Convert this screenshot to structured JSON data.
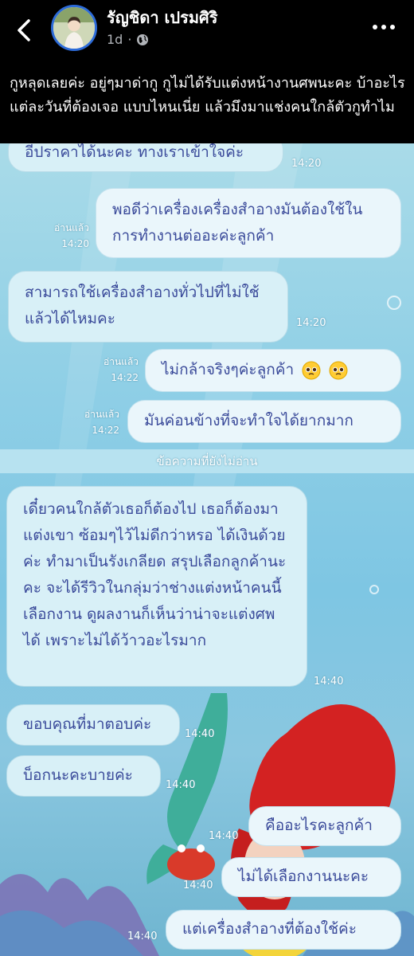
{
  "post": {
    "author_name": "รัญชิดา เปรมศิริ",
    "time_ago": "1d",
    "caption": "กูหลุดเลยค่ะ อยู่ๆมาด่ากู กูไม่ได้รับแต่งหน้างานศพนะคะ บ้าอะไร แต่ละวันที่ต้องเจอ แบบไหนเนี่ย แล้วมึงมาแช่งคนใกล้ตัวกูทำไม"
  },
  "chat": {
    "unread_label": "ข้อความที่ยังไม่อ่าน",
    "messages": [
      {
        "text": "อีปราคาได้นะคะ ทางเราเข้าใจค่ะ",
        "time": "14:20"
      },
      {
        "text": "พอดีว่าเครื่องเครื่องสำอางมันต้องใช้ในการทำงานต่ออะค่ะลูกค้า",
        "time": "14:20",
        "read": "อ่านแล้ว"
      },
      {
        "text": "สามารถใช้เครื่องสำอางทั่วไปที่ไม่ใช้แล้วได้ไหมคะ",
        "time": "14:20"
      },
      {
        "text": "ไม่กล้าจริงๆค่ะลูกค้า",
        "time": "14:22",
        "read": "อ่านแล้ว"
      },
      {
        "text": "มันค่อนข้างที่จะทำใจได้ยากมาก",
        "time": "14:22",
        "read": "อ่านแล้ว"
      },
      {
        "text": "เดี๋ยวคนใกล้ตัวเธอก็ต้องไป เธอก็ต้องมาแต่งเขา ซ้อมๆไว้ไม่ดีกว่าหรอ ได้เงินด้วยค่ะ ทำมาเป็นรังเกลียด สรุปเลือกลูกค้านะคะ จะได้รีวิวในกลุ่มว่าช่างแต่งหน้าคนนี้เลือกงาน ดูผลงานก็เห็นว่าน่าจะแต่งศพได้ เพราะไม่ได้ว้าวอะไรมาก",
        "time": "14:40"
      },
      {
        "text": "ขอบคุณที่มาตอบค่ะ",
        "time": "14:40"
      },
      {
        "text": "บ็อกนะคะบายค่ะ",
        "time": "14:40"
      },
      {
        "text": "คืออะไรคะลูกค้า",
        "time": "14:40"
      },
      {
        "text": "ไม่ได้เลือกงานนะคะ",
        "time": "14:40"
      },
      {
        "text": "แต่เครื่องสำอางที่ต้องใช้ค่ะ",
        "time": "14:40"
      }
    ]
  },
  "icons": {
    "back": "chevron-left-icon",
    "more": "more-dots-icon",
    "privacy": "globe-icon",
    "emoji": "pleading-face-emoji"
  },
  "colors": {
    "header_bg": "#000000",
    "avatar_ring": "#2d6bd8",
    "bubble_text": "#3a4a9a",
    "chat_bg": "#8fcfe6"
  }
}
